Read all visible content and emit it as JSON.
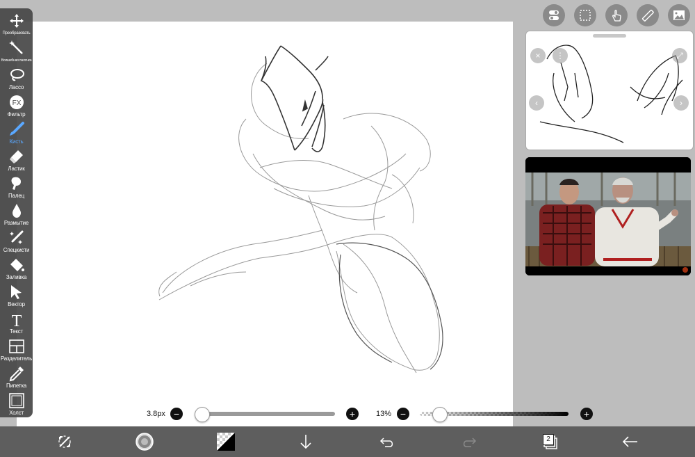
{
  "tools": [
    {
      "id": "transform",
      "label": "Преобразовать",
      "icon": "move-arrows-icon",
      "small": false
    },
    {
      "id": "magic-wand",
      "label": "Волшебная палочка",
      "icon": "magic-wand-icon",
      "small": true
    },
    {
      "id": "lasso",
      "label": "Лассо",
      "icon": "lasso-icon",
      "small": false
    },
    {
      "id": "filter",
      "label": "Фильтр",
      "icon": "fx-icon",
      "small": false
    },
    {
      "id": "brush",
      "label": "Кисть",
      "icon": "brush-icon",
      "small": false,
      "active": true
    },
    {
      "id": "eraser",
      "label": "Ластик",
      "icon": "eraser-icon",
      "small": false
    },
    {
      "id": "smudge",
      "label": "Палец",
      "icon": "finger-icon",
      "small": false
    },
    {
      "id": "blur",
      "label": "Размытие",
      "icon": "drop-icon",
      "small": false
    },
    {
      "id": "special",
      "label": "Спецкисти",
      "icon": "special-brush-icon",
      "small": false
    },
    {
      "id": "fill",
      "label": "Заливка",
      "icon": "bucket-icon",
      "small": false
    },
    {
      "id": "vector",
      "label": "Вектор",
      "icon": "cursor-icon",
      "small": false
    },
    {
      "id": "text",
      "label": "Текст",
      "icon": "text-icon",
      "small": false
    },
    {
      "id": "divider",
      "label": "Разделитель",
      "icon": "frame-divider-icon",
      "small": false
    },
    {
      "id": "eyedropper",
      "label": "Пипетка",
      "icon": "eyedropper-icon",
      "small": false
    },
    {
      "id": "canvas",
      "label": "Холст",
      "icon": "canvas-icon",
      "small": false
    }
  ],
  "top_buttons": [
    "toggle-settings-icon",
    "selection-icon",
    "touch-hand-icon",
    "ruler-icon",
    "image-reference-icon"
  ],
  "brush": {
    "size_label": "3.8px",
    "size_fraction": 0.03
  },
  "opacity": {
    "label": "13%",
    "value_fraction": 0.13
  },
  "bottom_bar": {
    "layer_count": "2",
    "buttons": [
      "transform-quick-icon",
      "brush-preview-icon",
      "color-swatch-icon",
      "download-arrow-icon",
      "undo-icon",
      "redo-icon",
      "layers-icon",
      "back-arrow-icon"
    ]
  },
  "colors": {
    "accent": "#5aa8ff",
    "toolbar": "#464646",
    "bottombar": "#5e5e5e",
    "background": "#bdbdbd"
  }
}
